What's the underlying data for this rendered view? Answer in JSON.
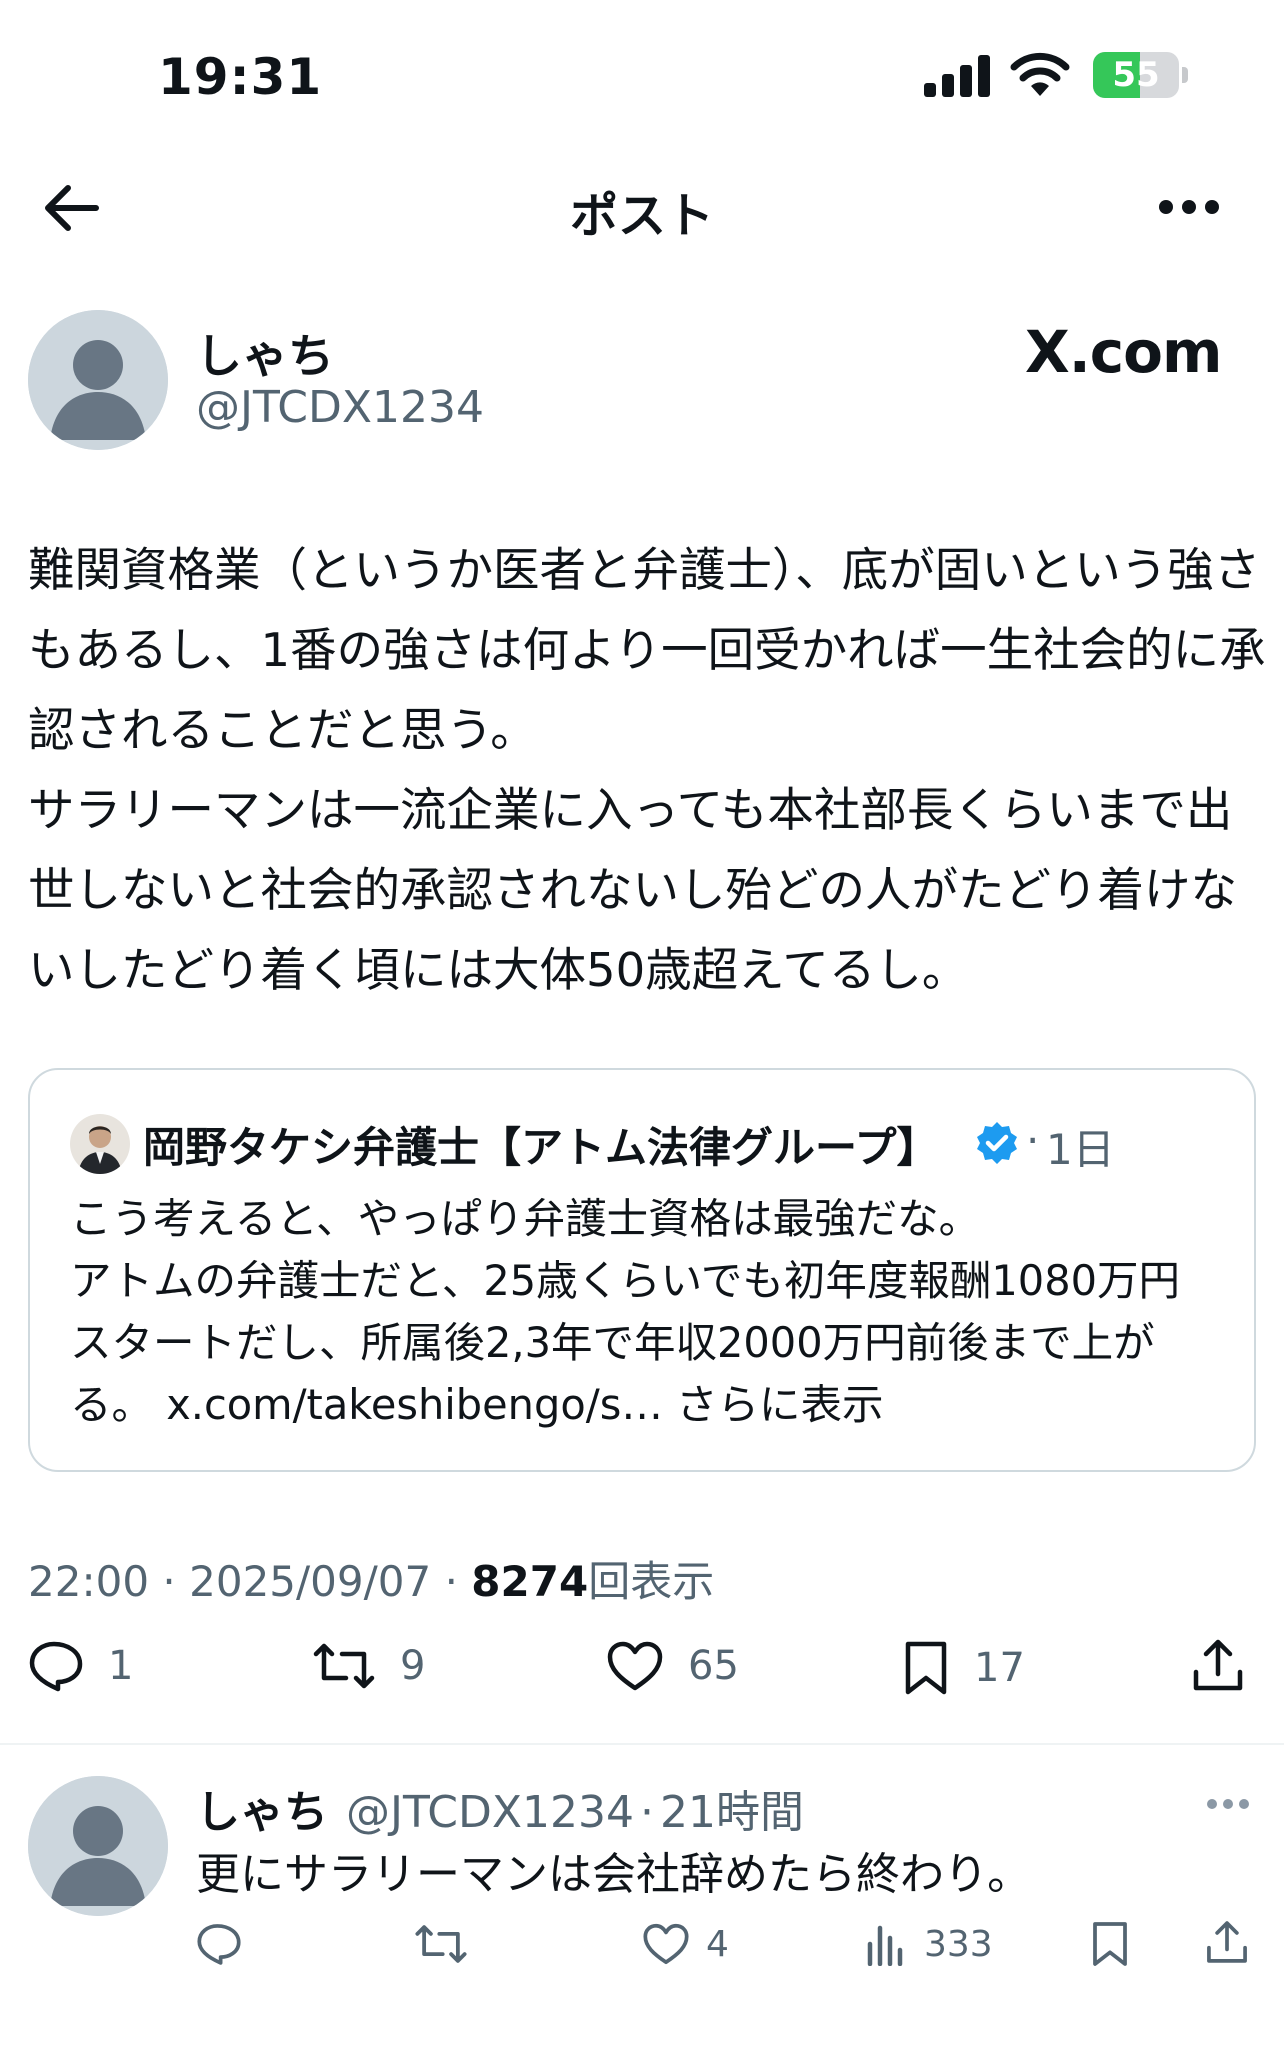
{
  "status_bar": {
    "time": "19:31",
    "battery_percent": "55",
    "battery_level": 0.55,
    "signal_icon": "cellular-signal-icon",
    "wifi_icon": "wifi-icon"
  },
  "nav": {
    "title": "ポスト",
    "back_icon": "back-arrow-icon",
    "more_icon": "more-horizontal-icon"
  },
  "post": {
    "author_name": "しゃち",
    "author_handle": "@JTCDX1234",
    "watermark": "X.com",
    "text": "難関資格業（というか医者と弁護士）、底が固いという強さもあるし、1番の強さは何より一回受かれば一生社会的に承認されることだと思う。\nサラリーマンは一流企業に入っても本社部長くらいまで出世しないと社会的承認されないし殆どの人がたどり着けないしたどり着く頃には大体50歳超えてるし。",
    "quote": {
      "author_name": "岡野タケシ弁護士【アトム法律グループ】",
      "verified_icon": "verified-badge-icon",
      "separator": "·",
      "age": "1日",
      "text": "こう考えると、やっぱり弁護士資格は最強だな。\nアトムの弁護士だと、25歳くらいでも初年度報酬1080万円スタートだし、所属後2,3年で年収2000万円前後まで上がる。 x.com/takeshibengo/s…",
      "show_more": "さらに表示"
    },
    "meta": {
      "time": "22:00",
      "separator": "·",
      "date": "2025/09/07",
      "views_count": "8274",
      "views_label": "回表示"
    },
    "actions": {
      "replies": "1",
      "reposts": "9",
      "likes": "65",
      "bookmarks": "17"
    }
  },
  "reply": {
    "author_name": "しゃち",
    "author_handle": "@JTCDX1234",
    "separator": "·",
    "age": "21時間",
    "text": "更にサラリーマンは会社辞めたら終わり。",
    "likes": "4",
    "views": "333"
  },
  "colors": {
    "text_primary": "#0f1419",
    "text_secondary": "#536471",
    "verified_blue": "#1d9bf0",
    "battery_green": "#35c759",
    "border": "#cfd9de"
  }
}
